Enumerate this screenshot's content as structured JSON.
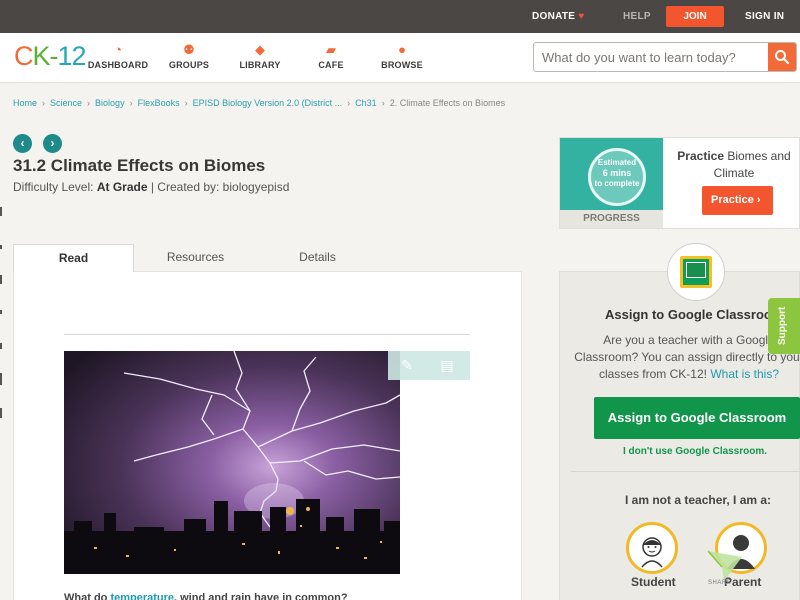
{
  "topbar": {
    "donate": "DONATE",
    "help": "HELP",
    "join": "JOIN",
    "sign_in": "SIGN IN"
  },
  "header": {
    "logo": {
      "c": "C",
      "k": "K",
      "dash": "-",
      "n": "12"
    },
    "nav": [
      {
        "label": "DASHBOARD",
        "icon": "gauge-icon"
      },
      {
        "label": "GROUPS",
        "icon": "people-icon"
      },
      {
        "label": "LIBRARY",
        "icon": "book-icon"
      },
      {
        "label": "CAFE",
        "icon": "chat-icon"
      },
      {
        "label": "BROWSE",
        "icon": "lightbulb-icon"
      }
    ],
    "search": {
      "placeholder": "What do you want to learn today?"
    }
  },
  "breadcrumb": {
    "items": [
      "Home",
      "Science",
      "Biology",
      "FlexBooks",
      "EPISD Biology Version 2.0 (District ...",
      "Ch31"
    ],
    "current": "2. Climate Effects on Biomes"
  },
  "article": {
    "title": "31.2 Climate Effects on Biomes",
    "difficulty_label": "Difficulty Level:",
    "difficulty_value": "At Grade",
    "created_by": "| Created by: biologyepisd",
    "tabs": [
      "Read",
      "Resources",
      "Details"
    ],
    "question": {
      "before": "What do ",
      "link": "temperature",
      "after": ", wind and rain have in common?"
    }
  },
  "practice": {
    "estimate_top": "Estimated",
    "estimate_mid": "6 mins",
    "estimate_bottom": "to complete",
    "progress": "PROGRESS",
    "title_bold": "Practice",
    "title_rest": " Biomes and Climate",
    "button": "Practice"
  },
  "google_classroom": {
    "title": "Assign to Google Classroom",
    "description": "Are you a teacher with a Google Classroom? You can assign directly to your classes from CK-12!",
    "what_link": "What is this?",
    "assign_button": "Assign to Google Classroom",
    "dont_use": "I don't use Google Classroom.",
    "not_teacher": "I am not a teacher, I am a:",
    "roles": [
      "Student",
      "Parent"
    ]
  },
  "support": "Support",
  "share": "SHARE",
  "colors": {
    "accent_orange": "#f26a37",
    "teal": "#1f8a8a",
    "google_green": "#11954a",
    "support_green": "#8cc63e"
  }
}
